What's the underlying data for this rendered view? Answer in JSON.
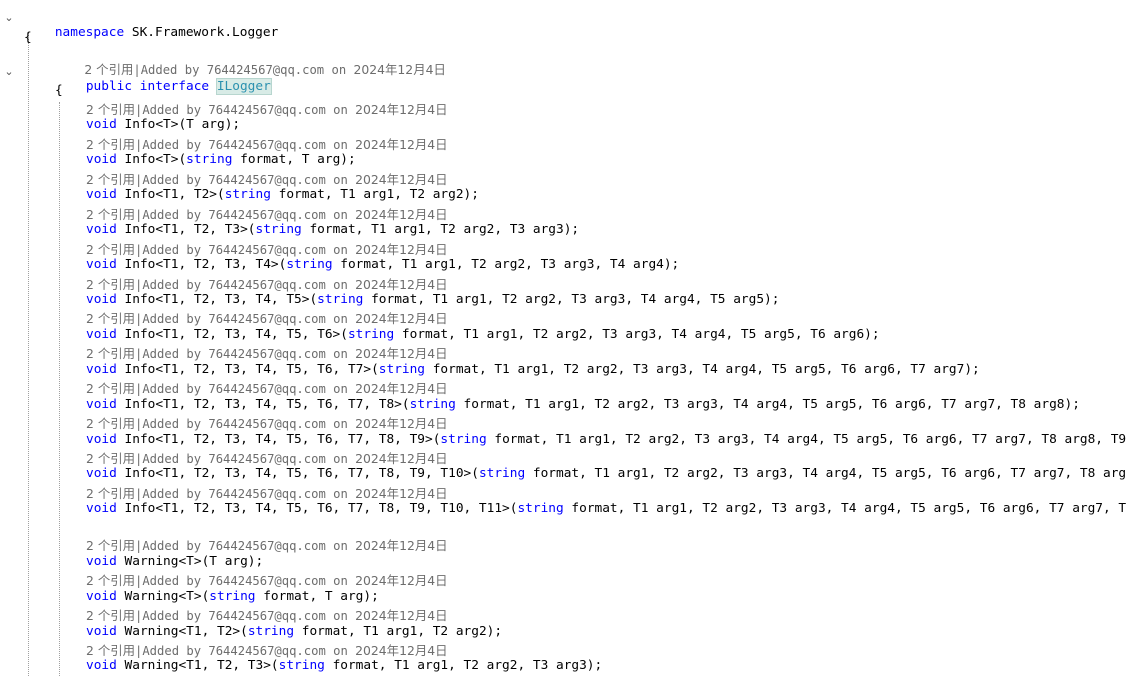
{
  "namespace_line": {
    "keyword": "namespace",
    "name": "SK.Framework.Logger"
  },
  "brace_open": "{",
  "lens_text": {
    "refs": "2 个引用",
    "sep": "|",
    "added": "Added by 764424567@qq.com on ",
    "date": "2024年12月4日"
  },
  "interface_line": {
    "kw1": "public",
    "kw2": "interface",
    "name": "ILogger"
  },
  "code_lines": [
    "void Info<T>(T arg);",
    "void Info<T>(string format, T arg);",
    "void Info<T1, T2>(string format, T1 arg1, T2 arg2);",
    "void Info<T1, T2, T3>(string format, T1 arg1, T2 arg2, T3 arg3);",
    "void Info<T1, T2, T3, T4>(string format, T1 arg1, T2 arg2, T3 arg3, T4 arg4);",
    "void Info<T1, T2, T3, T4, T5>(string format, T1 arg1, T2 arg2, T3 arg3, T4 arg4, T5 arg5);",
    "void Info<T1, T2, T3, T4, T5, T6>(string format, T1 arg1, T2 arg2, T3 arg3, T4 arg4, T5 arg5, T6 arg6);",
    "void Info<T1, T2, T3, T4, T5, T6, T7>(string format, T1 arg1, T2 arg2, T3 arg3, T4 arg4, T5 arg5, T6 arg6, T7 arg7);",
    "void Info<T1, T2, T3, T4, T5, T6, T7, T8>(string format, T1 arg1, T2 arg2, T3 arg3, T4 arg4, T5 arg5, T6 arg6, T7 arg7, T8 arg8);",
    "void Info<T1, T2, T3, T4, T5, T6, T7, T8, T9>(string format, T1 arg1, T2 arg2, T3 arg3, T4 arg4, T5 arg5, T6 arg6, T7 arg7, T8 arg8, T9",
    "void Info<T1, T2, T3, T4, T5, T6, T7, T8, T9, T10>(string format, T1 arg1, T2 arg2, T3 arg3, T4 arg4, T5 arg5, T6 arg6, T7 arg7, T8 arg",
    "void Info<T1, T2, T3, T4, T5, T6, T7, T8, T9, T10, T11>(string format, T1 arg1, T2 arg2, T3 arg3, T4 arg4, T5 arg5, T6 arg6, T7 arg7, T",
    "",
    "void Warning<T>(T arg);",
    "void Warning<T>(string format, T arg);",
    "void Warning<T1, T2>(string format, T1 arg1, T2 arg2);",
    "void Warning<T1, T2, T3>(string format, T1 arg1, T2 arg2, T3 arg3);"
  ],
  "colors": {
    "keyword": "#0000ff",
    "type": "#2b91af",
    "lens": "#6d6d6d",
    "highlight": "#d8ebe6"
  },
  "icons": {
    "fold": "chevron-down-icon"
  }
}
